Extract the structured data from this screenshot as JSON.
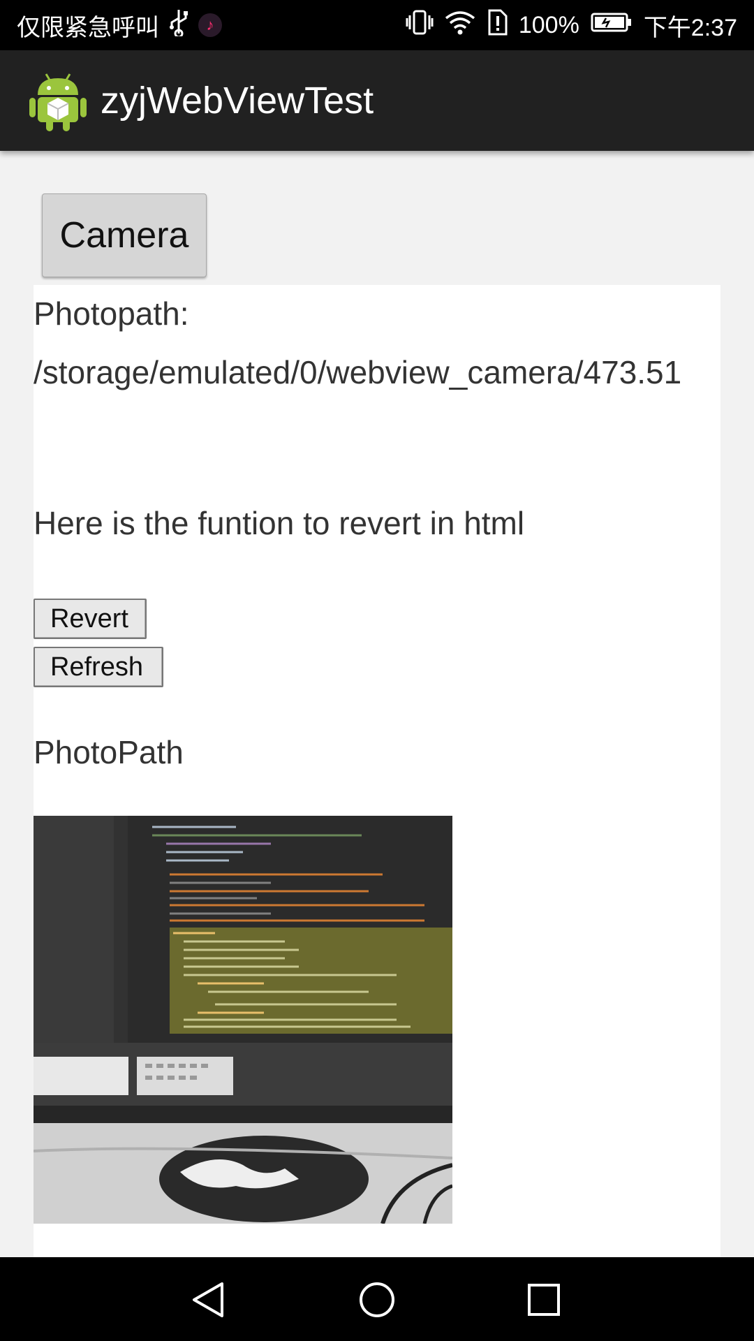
{
  "status_bar": {
    "carrier": "仅限紧急呼叫",
    "battery": "100%",
    "time": "下午2:37",
    "icons": [
      "usb-icon",
      "tiktok-icon",
      "vibrate-icon",
      "wifi-icon",
      "sim-alert-icon",
      "battery-icon"
    ]
  },
  "app_bar": {
    "title": "zyjWebViewTest",
    "icon": "android-app-icon"
  },
  "camera_button": {
    "label": "Camera"
  },
  "webview": {
    "photopath_label": "Photopath:",
    "photopath_value": "/storage/emulated/0/webview_camera/473.51",
    "function_text": "Here is the funtion to revert in html",
    "revert_label": "Revert",
    "refresh_label": "Refresh",
    "photopath_heading": "PhotoPath"
  },
  "nav_bar": {
    "icons": [
      "back-icon",
      "home-icon",
      "recents-icon"
    ]
  },
  "colors": {
    "status_bar": "#000000",
    "app_bar": "#212121",
    "background": "#f2f2f2",
    "android_green": "#9bc53d"
  }
}
